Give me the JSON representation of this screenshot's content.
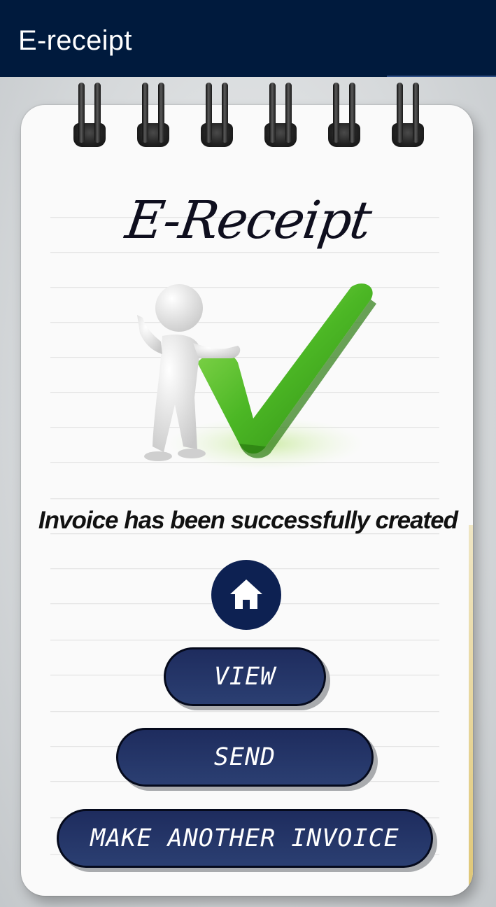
{
  "appbar": {
    "title": "E-receipt"
  },
  "page": {
    "heading": "E-Receipt",
    "message": "Invoice has been successfully created"
  },
  "home_icon": "home-icon",
  "buttons": {
    "view": "VIEW",
    "send": "SEND",
    "make_another": "MAKE ANOTHER INVOICE"
  },
  "colors": {
    "appbar": "#001a3d",
    "button": "#1e2c5e",
    "check": "#4cb725"
  }
}
